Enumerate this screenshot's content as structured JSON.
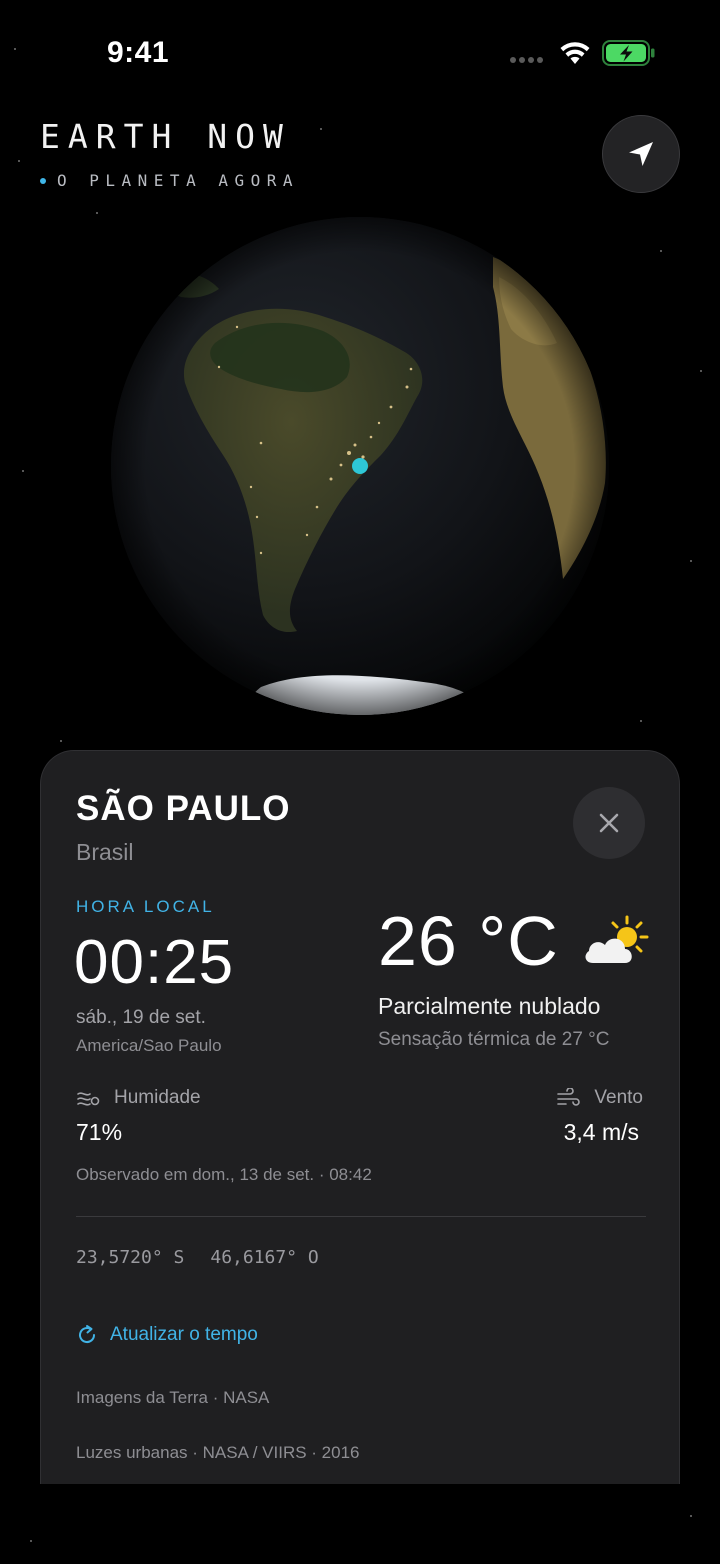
{
  "status_bar": {
    "time": "9:41"
  },
  "header": {
    "title": "EARTH NOW",
    "subtitle": "O PLANETA AGORA"
  },
  "globe": {
    "marker_color": "#2ec7d6"
  },
  "card": {
    "city": "SÃO PAULO",
    "country": "Brasil",
    "local_time_label": "HORA LOCAL",
    "local_time": "00:25",
    "local_date": "sáb., 19 de set.",
    "timezone": "America/Sao Paulo",
    "temperature": "26 °C",
    "weather_icon": "partly-cloudy-icon",
    "condition": "Parcialmente nublado",
    "feels_like": "Sensação térmica de 27 °C",
    "humidity_label": "Humidade",
    "humidity_value": "71%",
    "wind_label": "Vento",
    "wind_value": "3,4 m/s",
    "observed": "Observado em dom., 13 de set. · 08:42",
    "latitude": "23,5720° S",
    "longitude": "46,6167° O",
    "refresh_label": "Atualizar o tempo",
    "credit_imagery": "Imagens da Terra · NASA",
    "credit_lights": "Luzes urbanas · NASA / VIIRS · 2016"
  },
  "colors": {
    "accent": "#41b3e6",
    "card_bg": "#1f1f21",
    "battery": "#4cd964",
    "sun": "#f5c518"
  }
}
